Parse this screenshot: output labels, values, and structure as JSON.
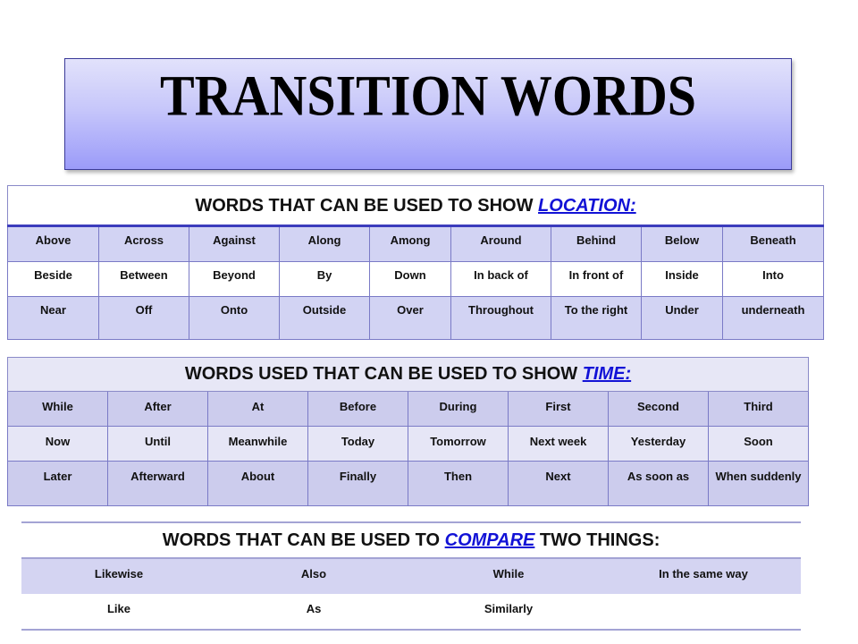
{
  "title": "TRANSITION WORDS",
  "colors": {
    "keyword": "#1212d6",
    "border": "#7a7ac6",
    "row_tint": "#d2d3f3"
  },
  "location": {
    "heading_prefix": "WORDS THAT CAN BE USED TO SHOW ",
    "heading_keyword": "LOCATION:",
    "heading_suffix": "",
    "rows": [
      [
        "Above",
        "Across",
        "Against",
        "Along",
        "Among",
        "Around",
        "Behind",
        "Below",
        "Beneath"
      ],
      [
        "Beside",
        "Between",
        "Beyond",
        "By",
        "Down",
        "In back of",
        "In front of",
        "Inside",
        "Into"
      ],
      [
        "Near",
        "Off",
        "Onto",
        "Outside",
        "Over",
        "Throughout",
        "To the right",
        "Under",
        "underneath"
      ]
    ]
  },
  "time": {
    "heading_prefix": "WORDS USED THAT CAN BE USED TO SHOW ",
    "heading_keyword": "TIME:",
    "heading_suffix": "",
    "rows": [
      [
        "While",
        "After",
        "At",
        "Before",
        "During",
        "First",
        "Second",
        "Third"
      ],
      [
        "Now",
        "Until",
        "Meanwhile",
        "Today",
        "Tomorrow",
        "Next week",
        "Yesterday",
        "Soon"
      ],
      [
        "Later",
        "Afterward",
        "About",
        "Finally",
        "Then",
        "Next",
        "As soon as",
        "When suddenly"
      ]
    ]
  },
  "compare": {
    "heading_prefix": "WORDS THAT CAN BE USED TO ",
    "heading_keyword": "COMPARE",
    "heading_suffix": " TWO THINGS:",
    "rows": [
      [
        "Likewise",
        "Also",
        "While",
        "In the same way"
      ],
      [
        "Like",
        "As",
        "Similarly",
        ""
      ]
    ]
  }
}
